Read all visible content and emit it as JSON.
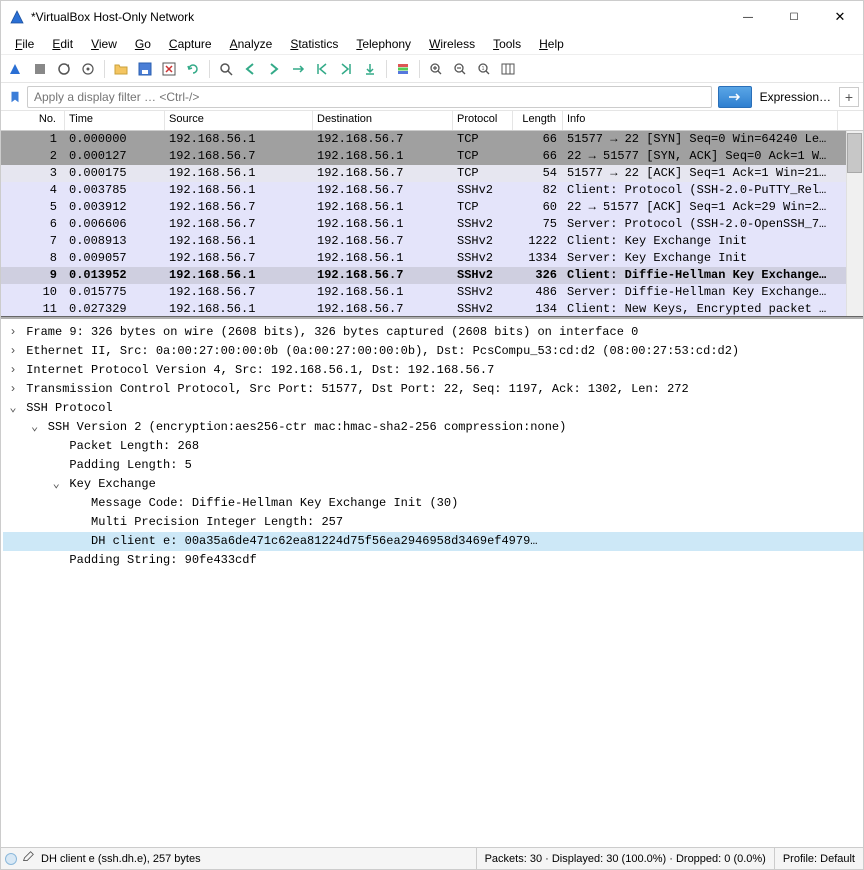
{
  "window": {
    "title": "*VirtualBox Host-Only Network"
  },
  "menu": [
    "File",
    "Edit",
    "View",
    "Go",
    "Capture",
    "Analyze",
    "Statistics",
    "Telephony",
    "Wireless",
    "Tools",
    "Help"
  ],
  "filter": {
    "placeholder": "Apply a display filter … <Ctrl-/>",
    "expression_label": "Expression…"
  },
  "columns": {
    "no": "No.",
    "time": "Time",
    "source": "Source",
    "destination": "Destination",
    "protocol": "Protocol",
    "length": "Length",
    "info": "Info"
  },
  "packets": [
    {
      "no": "1",
      "time": "0.000000",
      "src": "192.168.56.1",
      "dst": "192.168.56.7",
      "proto": "TCP",
      "len": "66",
      "info": "51577 → 22 [SYN] Seq=0 Win=64240 Le…",
      "bg": "#a0a0a0"
    },
    {
      "no": "2",
      "time": "0.000127",
      "src": "192.168.56.7",
      "dst": "192.168.56.1",
      "proto": "TCP",
      "len": "66",
      "info": "22 → 51577 [SYN, ACK] Seq=0 Ack=1 W…",
      "bg": "#a0a0a0"
    },
    {
      "no": "3",
      "time": "0.000175",
      "src": "192.168.56.1",
      "dst": "192.168.56.7",
      "proto": "TCP",
      "len": "54",
      "info": "51577 → 22 [ACK] Seq=1 Ack=1 Win=21…",
      "bg": "#e6e6f0"
    },
    {
      "no": "4",
      "time": "0.003785",
      "src": "192.168.56.1",
      "dst": "192.168.56.7",
      "proto": "SSHv2",
      "len": "82",
      "info": "Client: Protocol (SSH-2.0-PuTTY_Rel…",
      "bg": "#e4e4fa"
    },
    {
      "no": "5",
      "time": "0.003912",
      "src": "192.168.56.7",
      "dst": "192.168.56.1",
      "proto": "TCP",
      "len": "60",
      "info": "22 → 51577 [ACK] Seq=1 Ack=29 Win=2…",
      "bg": "#e4e4fa"
    },
    {
      "no": "6",
      "time": "0.006606",
      "src": "192.168.56.7",
      "dst": "192.168.56.1",
      "proto": "SSHv2",
      "len": "75",
      "info": "Server: Protocol (SSH-2.0-OpenSSH_7…",
      "bg": "#e4e4fa"
    },
    {
      "no": "7",
      "time": "0.008913",
      "src": "192.168.56.1",
      "dst": "192.168.56.7",
      "proto": "SSHv2",
      "len": "1222",
      "info": "Client: Key Exchange Init",
      "bg": "#e4e4fa"
    },
    {
      "no": "8",
      "time": "0.009057",
      "src": "192.168.56.7",
      "dst": "192.168.56.1",
      "proto": "SSHv2",
      "len": "1334",
      "info": "Server: Key Exchange Init",
      "bg": "#e4e4fa"
    },
    {
      "no": "9",
      "time": "0.013952",
      "src": "192.168.56.1",
      "dst": "192.168.56.7",
      "proto": "SSHv2",
      "len": "326",
      "info": "Client: Diffie-Hellman Key Exchange…",
      "bg": "#cfcfe0",
      "sel": true
    },
    {
      "no": "10",
      "time": "0.015775",
      "src": "192.168.56.7",
      "dst": "192.168.56.1",
      "proto": "SSHv2",
      "len": "486",
      "info": "Server: Diffie-Hellman Key Exchange…",
      "bg": "#e4e4fa"
    },
    {
      "no": "11",
      "time": "0.027329",
      "src": "192.168.56.1",
      "dst": "192.168.56.7",
      "proto": "SSHv2",
      "len": "134",
      "info": "Client: New Keys, Encrypted packet …",
      "bg": "#e4e4fa"
    }
  ],
  "details": [
    {
      "indent": 0,
      "twisty": ">",
      "text": "Frame 9: 326 bytes on wire (2608 bits), 326 bytes captured (2608 bits) on interface 0"
    },
    {
      "indent": 0,
      "twisty": ">",
      "text": "Ethernet II, Src: 0a:00:27:00:00:0b (0a:00:27:00:00:0b), Dst: PcsCompu_53:cd:d2 (08:00:27:53:cd:d2)"
    },
    {
      "indent": 0,
      "twisty": ">",
      "text": "Internet Protocol Version 4, Src: 192.168.56.1, Dst: 192.168.56.7"
    },
    {
      "indent": 0,
      "twisty": ">",
      "text": "Transmission Control Protocol, Src Port: 51577, Dst Port: 22, Seq: 1197, Ack: 1302, Len: 272"
    },
    {
      "indent": 0,
      "twisty": "v",
      "text": "SSH Protocol"
    },
    {
      "indent": 1,
      "twisty": "v",
      "text": "SSH Version 2 (encryption:aes256-ctr mac:hmac-sha2-256 compression:none)"
    },
    {
      "indent": 2,
      "twisty": " ",
      "text": "Packet Length: 268"
    },
    {
      "indent": 2,
      "twisty": " ",
      "text": "Padding Length: 5"
    },
    {
      "indent": 2,
      "twisty": "v",
      "text": "Key Exchange"
    },
    {
      "indent": 3,
      "twisty": " ",
      "text": "Message Code: Diffie-Hellman Key Exchange Init (30)"
    },
    {
      "indent": 3,
      "twisty": " ",
      "text": "Multi Precision Integer Length: 257"
    },
    {
      "indent": 3,
      "twisty": " ",
      "text": "DH client e: 00a35a6de471c62ea81224d75f56ea2946958d3469ef4979…",
      "sel": true
    },
    {
      "indent": 2,
      "twisty": " ",
      "text": "Padding String: 90fe433cdf"
    }
  ],
  "status": {
    "field": "DH client e (ssh.dh.e), 257 bytes",
    "stats": "Packets: 30 · Displayed: 30 (100.0%) · Dropped: 0 (0.0%)",
    "profile": "Profile: Default"
  }
}
